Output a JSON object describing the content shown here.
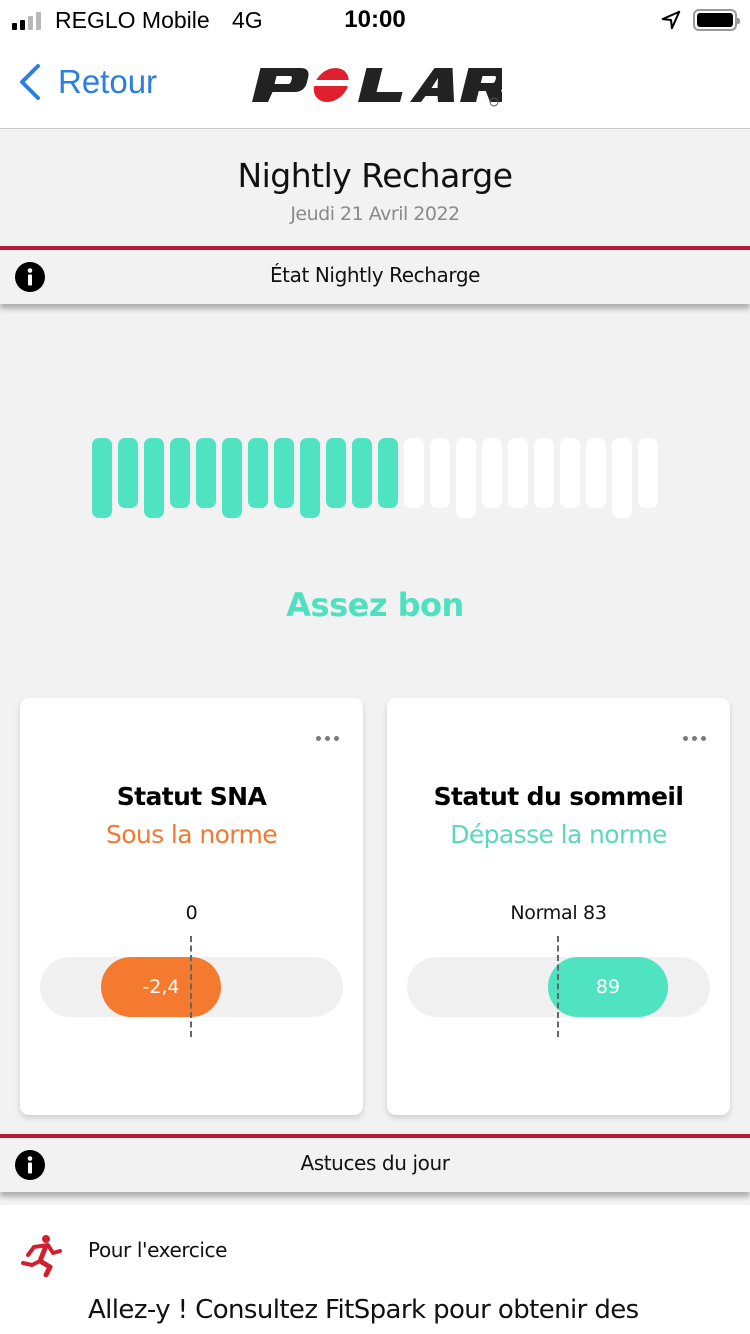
{
  "status_bar": {
    "carrier": "REGLO Mobile",
    "network": "4G",
    "time": "10:00",
    "signal_bars_active": 2,
    "signal_bars_total": 4,
    "battery_level": 1.0,
    "icons": [
      "signal-icon",
      "location-arrow-icon",
      "battery-icon"
    ]
  },
  "nav": {
    "back_label": "Retour",
    "back_icon": "chevron-left-icon",
    "logo": "POLAR",
    "logo_accent": "#e0202f"
  },
  "header": {
    "title": "Nightly Recharge",
    "date": "Jeudi 21 Avril 2022"
  },
  "sections": {
    "status": {
      "title": "État Nightly Recharge",
      "icon": "info-icon"
    },
    "tips": {
      "title": "Astuces du jour",
      "icon": "info-icon"
    }
  },
  "recharge": {
    "total_segments": 22,
    "filled_segments": 12,
    "long_segment_indices": [
      0,
      2,
      5,
      8,
      14,
      20
    ],
    "quality_label": "Assez bon",
    "colors": {
      "filled": "#4fe3c1",
      "empty": "#ffffff"
    }
  },
  "cards": [
    {
      "title": "Statut SNA",
      "status": "Sous la norme",
      "status_color": "#f07a34",
      "reference_label": "0",
      "value_label": "-2,4",
      "value_fraction": 0.5,
      "reference_fraction": 0.5,
      "pill_offset_relative_to_ref": -0.74,
      "pill_color": "#f47a30",
      "more_label": "more-options"
    },
    {
      "title": "Statut du sommeil",
      "status": "Dépasse la norme",
      "status_color": "#5ad8bc",
      "reference_label": "Normal 83",
      "value_label": "89",
      "reference_fraction": 0.5,
      "pill_offset_relative_to_ref": 0.08,
      "pill_color": "#4fe3c1",
      "more_label": "more-options"
    }
  ],
  "tip": {
    "category": "Pour l'exercice",
    "icon": "running-person-icon",
    "icon_color": "#d0202f",
    "text": "Allez-y ! Consultez FitSpark pour obtenir des"
  },
  "colors": {
    "accent_red": "#b4183a",
    "link_blue": "#2a7fe0",
    "background": "#f2f2f2"
  }
}
